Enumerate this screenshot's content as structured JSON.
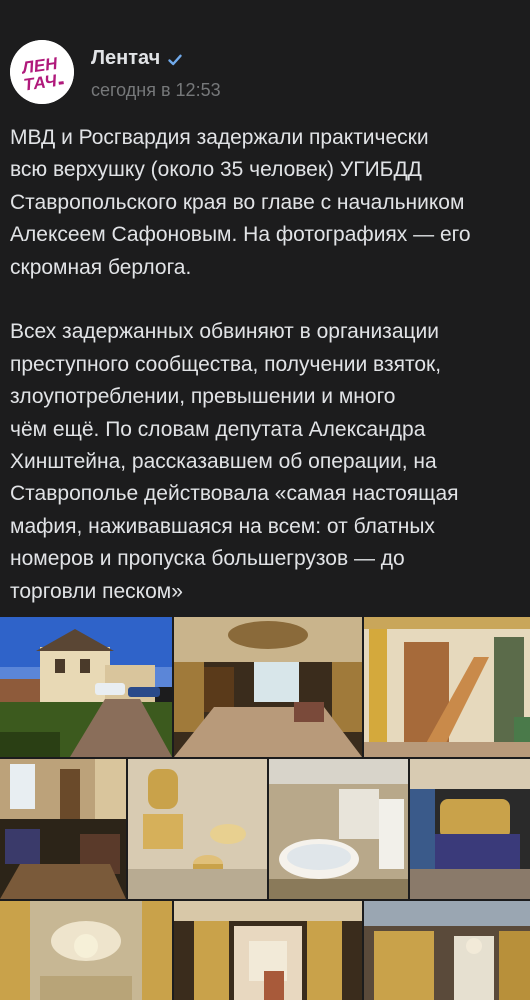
{
  "post": {
    "author": "Лентач",
    "time": "сегодня в 12:53",
    "avatar_text": "ЛЕН ТАЧ",
    "text": "МВД и Росгвардия задержали практически\nвсю верхушку (около 35 человек) УГИБДД\nСтавропольского края во главе с начальником\nАлексеем Сафоновым. На фотографиях — его\nскромная берлога.\n\nВсех задержанных обвиняют в организации\nпреступного сообщества, получении взяток,\nзлоупотреблении, превышении и много\nчём ещё. По словам депутата Александра\nХинштейна, рассказавшем об операции, на\nСтаврополье действовала «самая настоящая\nмафия, наживавшаяся на всем: от блатных\nномеров и пропуска большегрузов — до\nторговли песком»"
  },
  "icons": {
    "verified": "verified-check-icon",
    "menu": "more-options-icon"
  },
  "colors": {
    "background": "#1c1c1d",
    "text": "#e1e3e6",
    "secondary": "#76787a",
    "accent": "#71aaeb",
    "brand": "#b0197b"
  },
  "gallery": [
    {
      "subject": "mansion exterior"
    },
    {
      "subject": "hall with ornate ceiling"
    },
    {
      "subject": "staircase"
    },
    {
      "subject": "living room"
    },
    {
      "subject": "golden bathroom"
    },
    {
      "subject": "bathroom with bathtub"
    },
    {
      "subject": "bedroom"
    },
    {
      "subject": "ceiling with chandelier"
    },
    {
      "subject": "golden doorway"
    },
    {
      "subject": "golden wardrobe"
    }
  ]
}
